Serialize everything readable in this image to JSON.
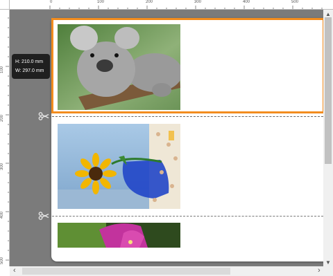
{
  "ruler": {
    "top_labels": [
      "0",
      "100",
      "200",
      "300",
      "400",
      "500"
    ],
    "left_labels": [
      "100",
      "200",
      "300",
      "400",
      "500"
    ]
  },
  "tooltip": {
    "height": "H: 210.0 mm",
    "width": "W: 297.0 mm"
  },
  "photos": [
    {
      "name": "koala",
      "colors": [
        "#6f9b59",
        "#9a9a9a",
        "#7a5a3a"
      ]
    },
    {
      "name": "sunflower",
      "colors": [
        "#9fc3e0",
        "#f2b600",
        "#1f4fcf"
      ]
    },
    {
      "name": "flower",
      "colors": [
        "#4b7d2a",
        "#c2339d"
      ]
    }
  ],
  "colors": {
    "selection": "#f28c1e",
    "canvas": "#7b7b7b"
  },
  "scrollbar": {
    "left_arrow": "‹",
    "right_arrow": "›",
    "up_arrow": "▲",
    "down_arrow": "▼"
  }
}
